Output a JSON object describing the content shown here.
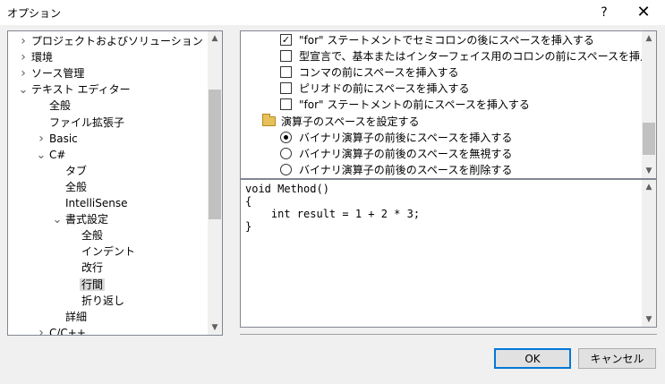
{
  "window": {
    "title": "オプション",
    "help": "?",
    "close": "✕"
  },
  "tree": {
    "items": [
      {
        "label": "プロジェクトおよびソリューション",
        "chevron": ">",
        "depth": 0
      },
      {
        "label": "環境",
        "chevron": ">",
        "depth": 0
      },
      {
        "label": "ソース管理",
        "chevron": ">",
        "depth": 0
      },
      {
        "label": "テキスト エディター",
        "chevron": "v",
        "depth": 0
      },
      {
        "label": "全般",
        "chevron": "",
        "depth": 1
      },
      {
        "label": "ファイル拡張子",
        "chevron": "",
        "depth": 1
      },
      {
        "label": "Basic",
        "chevron": ">",
        "depth": 1
      },
      {
        "label": "C#",
        "chevron": "v",
        "depth": 1
      },
      {
        "label": "タブ",
        "chevron": "",
        "depth": 2
      },
      {
        "label": "全般",
        "chevron": "",
        "depth": 2
      },
      {
        "label": "IntelliSense",
        "chevron": "",
        "depth": 2
      },
      {
        "label": "書式設定",
        "chevron": "v",
        "depth": 2
      },
      {
        "label": "全般",
        "chevron": "",
        "depth": 3
      },
      {
        "label": "インデント",
        "chevron": "",
        "depth": 3
      },
      {
        "label": "改行",
        "chevron": "",
        "depth": 3
      },
      {
        "label": "行間",
        "chevron": "",
        "depth": 3,
        "selected": true
      },
      {
        "label": "折り返し",
        "chevron": "",
        "depth": 3
      },
      {
        "label": "詳細",
        "chevron": "",
        "depth": 2
      },
      {
        "label": "C/C++",
        "chevron": ">",
        "depth": 1
      }
    ]
  },
  "options": {
    "items": [
      {
        "kind": "checkbox",
        "checked": true,
        "label": "\"for\" ステートメントでセミコロンの後にスペースを挿入する"
      },
      {
        "kind": "checkbox",
        "checked": false,
        "label": "型宣言で、基本またはインターフェイス用のコロンの前にスペースを挿入する"
      },
      {
        "kind": "checkbox",
        "checked": false,
        "label": "コンマの前にスペースを挿入する"
      },
      {
        "kind": "checkbox",
        "checked": false,
        "label": "ピリオドの前にスペースを挿入する"
      },
      {
        "kind": "checkbox",
        "checked": false,
        "label": "\"for\" ステートメントの前にスペースを挿入する"
      },
      {
        "kind": "group",
        "label": "演算子のスペースを設定する"
      },
      {
        "kind": "radio",
        "checked": true,
        "label": "バイナリ演算子の前後にスペースを挿入する"
      },
      {
        "kind": "radio",
        "checked": false,
        "label": "バイナリ演算子の前後のスペースを無視する"
      },
      {
        "kind": "radio",
        "checked": false,
        "label": "バイナリ演算子の前後のスペースを削除する"
      }
    ]
  },
  "preview": {
    "code": "void Method()\n{\n    int result = 1 + 2 * 3;\n}"
  },
  "buttons": {
    "ok": "OK",
    "cancel": "キャンセル"
  },
  "scroll": {
    "tree_position": 0.3,
    "options_position": 0.9
  },
  "colors": {
    "accent": "#0078d7",
    "selection": "#d9d9d9"
  }
}
